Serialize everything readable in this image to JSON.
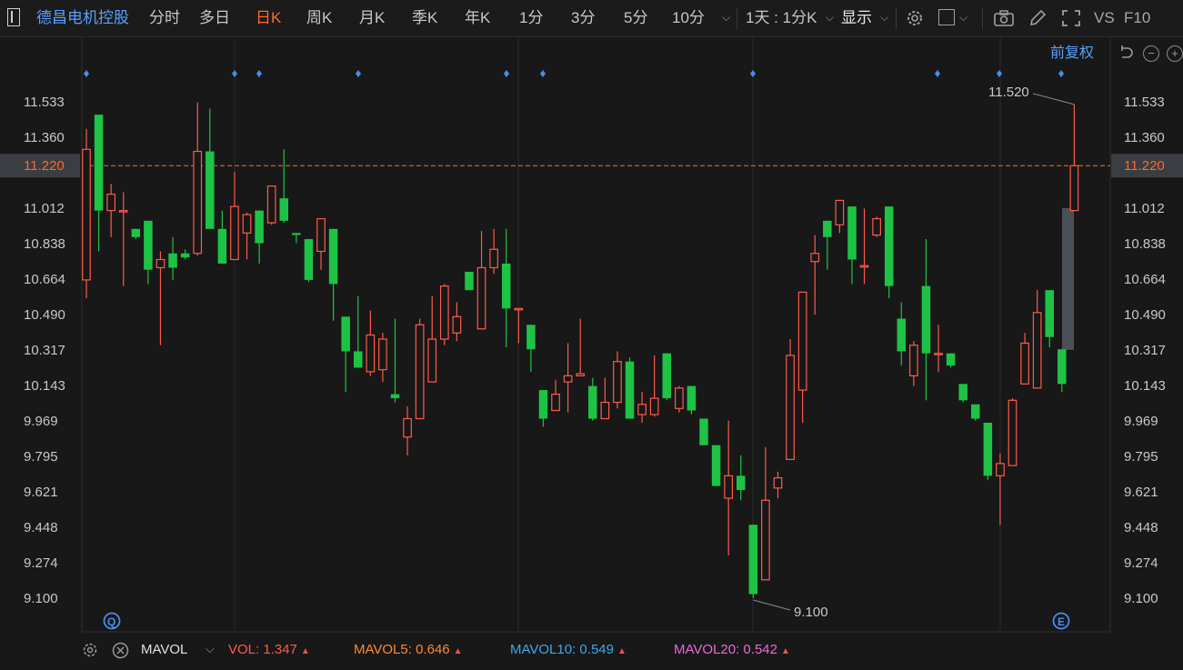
{
  "toolbar": {
    "stock_name": "德昌电机控股",
    "tabs": [
      "分时",
      "多日",
      "日K",
      "周K",
      "月K",
      "季K",
      "年K",
      "1分",
      "3分",
      "5分",
      "10分"
    ],
    "active_tab": "日K",
    "period_select": "1天 : 1分K",
    "display_label": "显示",
    "vs_label": "VS",
    "f10_label": "F10",
    "adjust_label": "前复权"
  },
  "chart_data": {
    "type": "candlestick",
    "y_ticks": [
      "11.533",
      "11.360",
      "11.220",
      "11.012",
      "10.838",
      "10.664",
      "10.490",
      "10.317",
      "10.143",
      "9.969",
      "9.795",
      "9.621",
      "9.448",
      "9.274",
      "9.100"
    ],
    "ylim": [
      9.1,
      11.533
    ],
    "current_price": "11.220",
    "max_label": "11.520",
    "min_label": "9.100",
    "colors": {
      "up": "#ff5a4a",
      "down": "#1ec345",
      "price_line": "#ff6a2a",
      "marker": "#4a8cf0",
      "grid": "#2a2a2a"
    },
    "candles": [
      {
        "o": 10.66,
        "h": 11.4,
        "l": 10.57,
        "c": 11.3
      },
      {
        "o": 11.47,
        "h": 11.47,
        "l": 10.8,
        "c": 11.0
      },
      {
        "o": 11.0,
        "h": 11.13,
        "l": 10.87,
        "c": 11.08
      },
      {
        "o": 11.0,
        "h": 11.09,
        "l": 10.63,
        "c": 11.0
      },
      {
        "o": 10.91,
        "h": 10.91,
        "l": 10.86,
        "c": 10.87
      },
      {
        "o": 10.95,
        "h": 10.95,
        "l": 10.64,
        "c": 10.71
      },
      {
        "o": 10.72,
        "h": 10.8,
        "l": 10.34,
        "c": 10.76
      },
      {
        "o": 10.79,
        "h": 10.87,
        "l": 10.66,
        "c": 10.72
      },
      {
        "o": 10.79,
        "h": 10.81,
        "l": 10.76,
        "c": 10.77
      },
      {
        "o": 10.79,
        "h": 11.53,
        "l": 10.78,
        "c": 11.29
      },
      {
        "o": 11.29,
        "h": 11.5,
        "l": 10.94,
        "c": 10.91
      },
      {
        "o": 10.91,
        "h": 11.0,
        "l": 10.74,
        "c": 10.74
      },
      {
        "o": 10.76,
        "h": 11.19,
        "l": 10.76,
        "c": 11.02
      },
      {
        "o": 10.89,
        "h": 10.99,
        "l": 10.76,
        "c": 10.98
      },
      {
        "o": 11.0,
        "h": 11.0,
        "l": 10.74,
        "c": 10.84
      },
      {
        "o": 10.94,
        "h": 11.12,
        "l": 10.93,
        "c": 11.12
      },
      {
        "o": 11.06,
        "h": 11.3,
        "l": 10.94,
        "c": 10.95
      },
      {
        "o": 10.89,
        "h": 10.89,
        "l": 10.84,
        "c": 10.88
      },
      {
        "o": 10.86,
        "h": 10.86,
        "l": 10.65,
        "c": 10.66
      },
      {
        "o": 10.8,
        "h": 10.9,
        "l": 10.71,
        "c": 10.96
      },
      {
        "o": 10.91,
        "h": 10.91,
        "l": 10.46,
        "c": 10.64
      },
      {
        "o": 10.48,
        "h": 10.48,
        "l": 10.11,
        "c": 10.31
      },
      {
        "o": 10.31,
        "h": 10.58,
        "l": 10.23,
        "c": 10.23
      },
      {
        "o": 10.21,
        "h": 10.51,
        "l": 10.19,
        "c": 10.39
      },
      {
        "o": 10.22,
        "h": 10.4,
        "l": 10.16,
        "c": 10.37
      },
      {
        "o": 10.1,
        "h": 10.47,
        "l": 10.06,
        "c": 10.08
      },
      {
        "o": 9.89,
        "h": 10.04,
        "l": 9.8,
        "c": 9.98
      },
      {
        "o": 9.98,
        "h": 10.47,
        "l": 9.98,
        "c": 10.44
      },
      {
        "o": 10.16,
        "h": 10.58,
        "l": 10.16,
        "c": 10.37
      },
      {
        "o": 10.37,
        "h": 10.64,
        "l": 10.34,
        "c": 10.63
      },
      {
        "o": 10.4,
        "h": 10.55,
        "l": 10.36,
        "c": 10.48
      },
      {
        "o": 10.7,
        "h": 10.7,
        "l": 10.61,
        "c": 10.61
      },
      {
        "o": 10.42,
        "h": 10.9,
        "l": 10.42,
        "c": 10.72
      },
      {
        "o": 10.72,
        "h": 10.91,
        "l": 10.69,
        "c": 10.81
      },
      {
        "o": 10.74,
        "h": 10.91,
        "l": 10.33,
        "c": 10.52
      },
      {
        "o": 10.52,
        "h": 10.52,
        "l": 10.35,
        "c": 10.52
      },
      {
        "o": 10.44,
        "h": 10.44,
        "l": 10.21,
        "c": 10.32
      },
      {
        "o": 10.12,
        "h": 10.12,
        "l": 9.94,
        "c": 9.98
      },
      {
        "o": 10.02,
        "h": 10.17,
        "l": 10.02,
        "c": 10.1
      },
      {
        "o": 10.16,
        "h": 10.35,
        "l": 10.01,
        "c": 10.19
      },
      {
        "o": 10.19,
        "h": 10.47,
        "l": 10.19,
        "c": 10.2
      },
      {
        "o": 10.14,
        "h": 10.18,
        "l": 9.97,
        "c": 9.98
      },
      {
        "o": 9.98,
        "h": 10.18,
        "l": 9.98,
        "c": 10.06
      },
      {
        "o": 10.06,
        "h": 10.31,
        "l": 10.03,
        "c": 10.26
      },
      {
        "o": 10.26,
        "h": 10.28,
        "l": 9.98,
        "c": 9.98
      },
      {
        "o": 10.0,
        "h": 10.11,
        "l": 9.96,
        "c": 10.05
      },
      {
        "o": 10.0,
        "h": 10.29,
        "l": 9.99,
        "c": 10.08
      },
      {
        "o": 10.3,
        "h": 10.3,
        "l": 10.07,
        "c": 10.08
      },
      {
        "o": 10.03,
        "h": 10.14,
        "l": 10.01,
        "c": 10.13
      },
      {
        "o": 10.14,
        "h": 10.14,
        "l": 10.0,
        "c": 10.02
      },
      {
        "o": 9.98,
        "h": 9.98,
        "l": 9.85,
        "c": 9.85
      },
      {
        "o": 9.85,
        "h": 9.85,
        "l": 9.65,
        "c": 9.65
      },
      {
        "o": 9.59,
        "h": 9.97,
        "l": 9.31,
        "c": 9.7
      },
      {
        "o": 9.7,
        "h": 9.8,
        "l": 9.58,
        "c": 9.63
      },
      {
        "o": 9.46,
        "h": 9.46,
        "l": 9.1,
        "c": 9.12
      },
      {
        "o": 9.19,
        "h": 9.84,
        "l": 9.19,
        "c": 9.58
      },
      {
        "o": 9.64,
        "h": 9.72,
        "l": 9.59,
        "c": 9.69
      },
      {
        "o": 9.78,
        "h": 10.37,
        "l": 9.78,
        "c": 10.29
      },
      {
        "o": 10.12,
        "h": 10.6,
        "l": 9.96,
        "c": 10.6
      },
      {
        "o": 10.75,
        "h": 10.88,
        "l": 10.49,
        "c": 10.79
      },
      {
        "o": 10.95,
        "h": 10.95,
        "l": 10.71,
        "c": 10.87
      },
      {
        "o": 10.93,
        "h": 11.05,
        "l": 10.89,
        "c": 11.05
      },
      {
        "o": 11.02,
        "h": 11.02,
        "l": 10.64,
        "c": 10.76
      },
      {
        "o": 10.73,
        "h": 11.01,
        "l": 10.64,
        "c": 10.73
      },
      {
        "o": 10.88,
        "h": 10.97,
        "l": 10.87,
        "c": 10.96
      },
      {
        "o": 11.02,
        "h": 11.02,
        "l": 10.57,
        "c": 10.63
      },
      {
        "o": 10.47,
        "h": 10.55,
        "l": 10.24,
        "c": 10.31
      },
      {
        "o": 10.19,
        "h": 10.36,
        "l": 10.14,
        "c": 10.34
      },
      {
        "o": 10.63,
        "h": 10.86,
        "l": 10.07,
        "c": 10.3
      },
      {
        "o": 10.3,
        "h": 10.44,
        "l": 10.21,
        "c": 10.3
      },
      {
        "o": 10.3,
        "h": 10.3,
        "l": 10.23,
        "c": 10.24
      },
      {
        "o": 10.15,
        "h": 10.15,
        "l": 10.06,
        "c": 10.07
      },
      {
        "o": 10.05,
        "h": 10.05,
        "l": 9.97,
        "c": 9.98
      },
      {
        "o": 9.96,
        "h": 9.96,
        "l": 9.68,
        "c": 9.7
      },
      {
        "o": 9.7,
        "h": 9.81,
        "l": 9.46,
        "c": 9.76
      },
      {
        "o": 9.75,
        "h": 10.08,
        "l": 9.75,
        "c": 10.07
      },
      {
        "o": 10.15,
        "h": 10.4,
        "l": 10.15,
        "c": 10.35
      },
      {
        "o": 10.13,
        "h": 10.61,
        "l": 10.13,
        "c": 10.5
      },
      {
        "o": 10.61,
        "h": 10.61,
        "l": 10.33,
        "c": 10.38
      },
      {
        "o": 10.32,
        "h": 10.32,
        "l": 10.11,
        "c": 10.15
      },
      {
        "o": 11.0,
        "h": 11.52,
        "l": 11.0,
        "c": 11.22
      }
    ],
    "event_marker_slots": [
      0,
      6,
      7,
      11,
      17,
      18,
      28,
      37,
      39,
      41
    ]
  },
  "volume_bar": {
    "indicator": "MAVOL",
    "items": [
      {
        "label": "VOL:",
        "value": "1.347",
        "color": "#ff5a4a"
      },
      {
        "label": "MAVOL5:",
        "value": "0.646",
        "color": "#ff8a2a"
      },
      {
        "label": "MAVOL10:",
        "value": "0.549",
        "color": "#3fa8e8"
      },
      {
        "label": "MAVOL20:",
        "value": "0.542",
        "color": "#e86ad8"
      }
    ]
  }
}
